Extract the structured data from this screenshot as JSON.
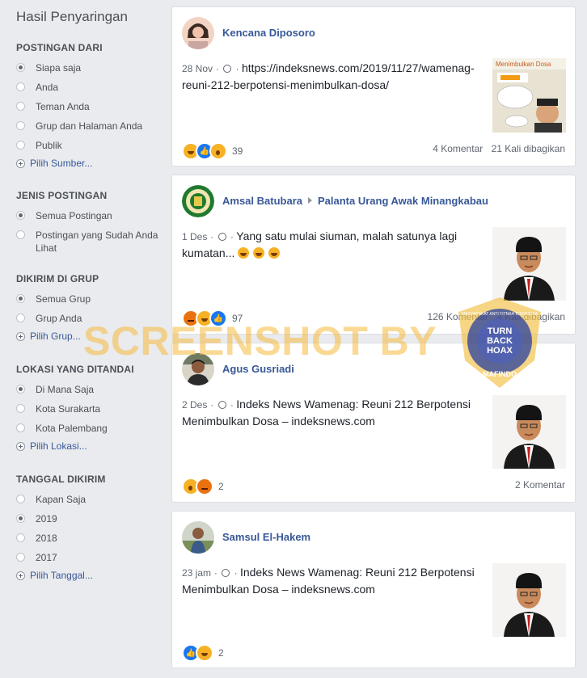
{
  "sidebar": {
    "title": "Hasil Penyaringan",
    "sections": [
      {
        "heading": "POSTINGAN DARI",
        "options": [
          "Siapa saja",
          "Anda",
          "Teman Anda",
          "Grup dan Halaman Anda",
          "Publik"
        ],
        "selected": 0,
        "more": "Pilih Sumber..."
      },
      {
        "heading": "JENIS POSTINGAN",
        "options": [
          "Semua Postingan",
          "Postingan yang Sudah Anda Lihat"
        ],
        "selected": 0
      },
      {
        "heading": "DIKIRIM DI GRUP",
        "options": [
          "Semua Grup",
          "Grup Anda"
        ],
        "selected": 0,
        "more": "Pilih Grup..."
      },
      {
        "heading": "LOKASI YANG DITANDAI",
        "options": [
          "Di Mana Saja",
          "Kota Surakarta",
          "Kota Palembang"
        ],
        "selected": 0,
        "more": "Pilih Lokasi..."
      },
      {
        "heading": "TANGGAL DIKIRIM",
        "options": [
          "Kapan Saja",
          "2019",
          "2018",
          "2017"
        ],
        "selected": 1,
        "more": "Pilih Tanggal..."
      }
    ]
  },
  "posts": [
    {
      "author": "Kencana Diposoro",
      "time": "28 Nov",
      "text": "https://indeksnews.com/2019/11/27/wamenag-reuni-212-berpotensi-menimbulkan-dosa/",
      "reactions": [
        "haha",
        "like",
        "wow"
      ],
      "reaction_count": "39",
      "comments": "4 Komentar",
      "shares": "21 Kali dibagikan",
      "thumb_caption": "Menimbulkan Dosa"
    },
    {
      "author": "Amsal Batubara",
      "group": "Palanta Urang Awak Minangkabau",
      "time": "1 Des",
      "text": "Yang satu mulai siuman, malah satunya lagi kumatan...",
      "reactions": [
        "angry",
        "haha",
        "like"
      ],
      "reaction_count": "97",
      "comments": "126 Komentar",
      "shares": "4 Kali dibagikan"
    },
    {
      "author": "Agus Gusriadi",
      "time": "2 Des",
      "text": "Indeks News Wamenag: Reuni 212 Berpotensi Menimbulkan Dosa – indeksnews.com",
      "reactions": [
        "wow",
        "angry"
      ],
      "reaction_count": "2",
      "comments": "2 Komentar",
      "shares": ""
    },
    {
      "author": "Samsul El-Hakem",
      "time": "23 jam",
      "text": "Indeks News Wamenag: Reuni 212 Berpotensi Menimbulkan Dosa – indeksnews.com",
      "reactions": [
        "like",
        "haha"
      ],
      "reaction_count": "2",
      "comments": "",
      "shares": ""
    }
  ],
  "watermark": {
    "text": "SCREENSHOT BY",
    "badge_line1": "TURN",
    "badge_line2": "BACK",
    "badge_line3": "HOAX",
    "badge_bottom": "MAFINDO",
    "badge_ring": "MASYARAKAT ANTI FITNAH INDONESIA"
  },
  "colors": {
    "link": "#385898",
    "like": "#1877f2",
    "haha": "#f7b125",
    "angry": "#e9710f",
    "watermark": "#f6b93c"
  }
}
